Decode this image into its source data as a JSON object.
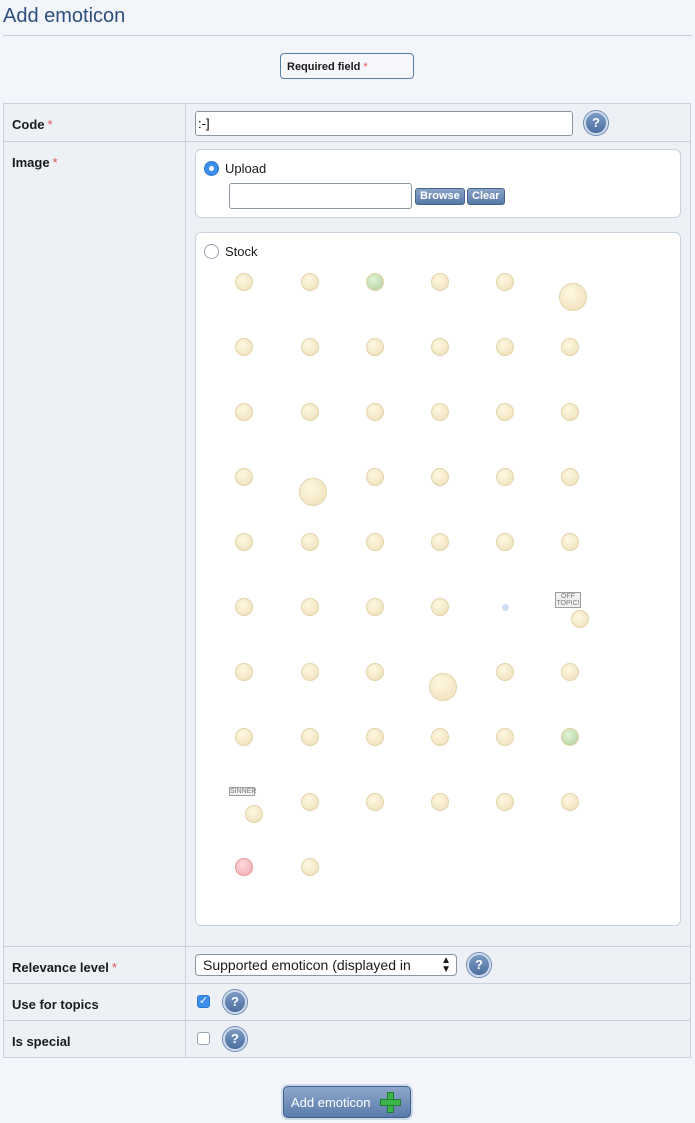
{
  "page": {
    "title": "Add emoticon"
  },
  "legend": {
    "required_label": "Required field",
    "star": "*"
  },
  "fields": {
    "code": {
      "label": "Code",
      "star": "*",
      "value": ":-]",
      "help": "?"
    },
    "image": {
      "label": "Image",
      "star": "*",
      "upload_label": "Upload",
      "upload_selected": true,
      "browse_label": "Browse",
      "clear_label": "Clear",
      "stock_label": "Stock",
      "stock_selected": false,
      "stock_icons": [
        "angel",
        "angry",
        "balloons",
        "blink",
        "blush",
        "boat",
        "grin",
        "santa",
        "tv",
        "confused",
        "cool",
        "cowboy",
        "girl",
        "cat",
        "neutral",
        "devil",
        "dizzy",
        "smile",
        "sneeze",
        "fishing",
        "surprised",
        "hand-mouth",
        "tongue",
        "guitar",
        "wave",
        "girl-hair",
        "idea",
        "crown",
        "happy",
        "laugh",
        "sleepy",
        "glasses",
        "ninja",
        "shy",
        "dot",
        "off-topic",
        "party",
        "shades",
        "sad",
        "bomb",
        "crazy-hair",
        "smirk",
        "frown",
        "frown-brows",
        "eek",
        "shock",
        "rabbit",
        "sick",
        "sinner",
        "smile-2",
        "headphones",
        "bald",
        "wink-eye",
        "smile-3",
        "heart",
        "whistle"
      ],
      "off_topic_sign": "OFF TOPIC!",
      "sinner_sign": "SINNER"
    },
    "relevance": {
      "label": "Relevance level",
      "star": "*",
      "value": "Supported emoticon (displayed in",
      "help": "?"
    },
    "use_for_topics": {
      "label": "Use for topics",
      "checked": true,
      "help": "?"
    },
    "is_special": {
      "label": "Is special",
      "checked": false,
      "help": "?"
    }
  },
  "submit": {
    "label": "Add emoticon"
  }
}
